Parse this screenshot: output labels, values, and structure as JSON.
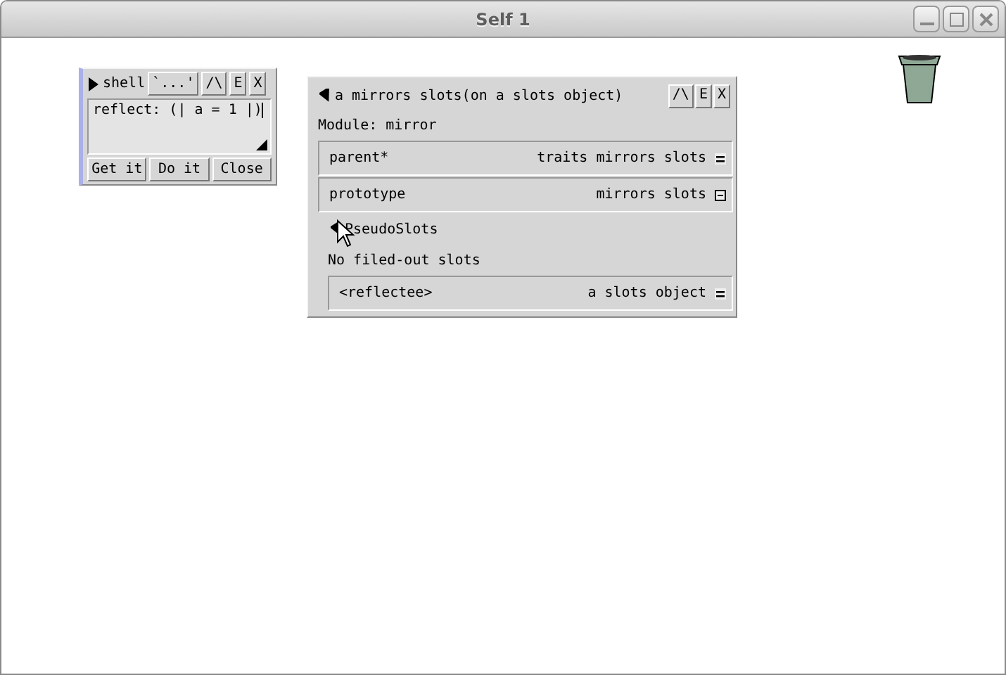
{
  "window": {
    "title": "Self 1"
  },
  "shell": {
    "title": "shell",
    "expanded": false,
    "buttons": [
      "`...'",
      "/\\",
      "E",
      "X"
    ],
    "text": "reflect: (| a = 1 |)",
    "actions": [
      "Get it",
      "Do it",
      "Close"
    ]
  },
  "outliner": {
    "title": "a mirrors slots(on a slots object)",
    "expanded": true,
    "buttons": [
      "/\\",
      "E",
      "X"
    ],
    "module": "Module: mirror",
    "slots": [
      {
        "name": "parent*",
        "value": "traits mirrors slots",
        "kind": "data"
      },
      {
        "name": "prototype",
        "value": "mirrors slots",
        "kind": "method"
      }
    ],
    "category": {
      "label": "PseudoSlots",
      "expanded": true
    },
    "note": "No filed-out slots",
    "pseudo_slots": [
      {
        "name": "<reflectee>",
        "value": "a slots object",
        "kind": "data"
      }
    ]
  }
}
